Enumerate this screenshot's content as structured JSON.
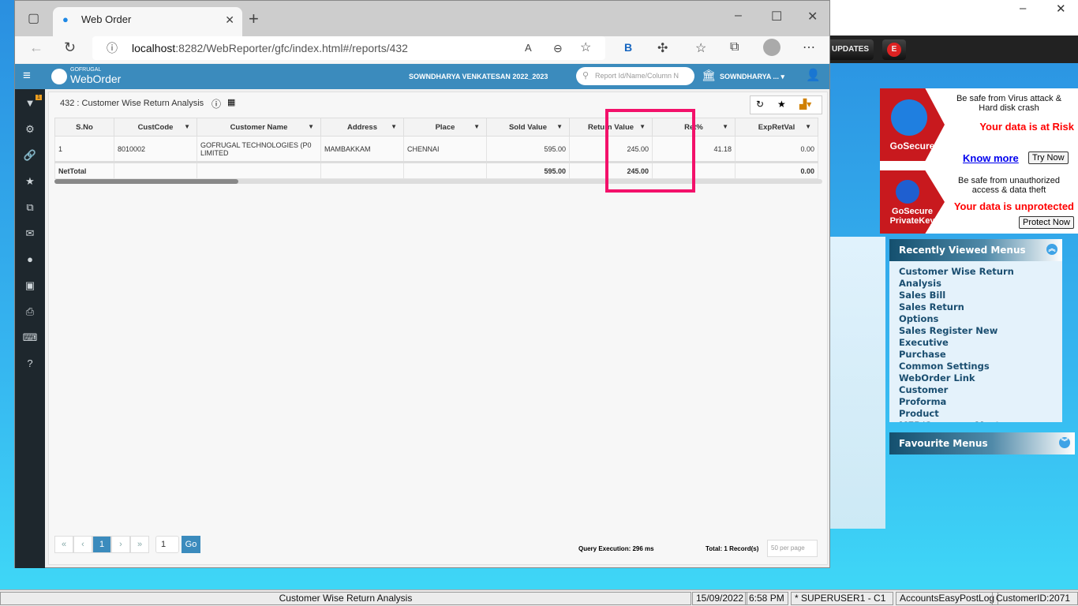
{
  "background_app": {
    "updates_label": "UPDATES",
    "e_label": "E",
    "ads": [
      {
        "brand": "GoSecure",
        "line1": "Be safe from Virus attack &",
        "line2": "Hard disk crash",
        "alert": "Your data is at Risk",
        "link": "Know more",
        "button": "Try Now"
      },
      {
        "brand": "GoSecure PrivateKey",
        "line1": "Be safe from unauthorized",
        "line2": "access & data theft",
        "alert": "Your data is unprotected",
        "button": "Protect Now"
      }
    ],
    "recently_viewed": {
      "title": "Recently Viewed Menus",
      "items": [
        "Customer Wise Return Analysis",
        "Sales Bill",
        "Sales Return",
        "Options",
        "Sales Register New",
        "Executive",
        "Purchase",
        "Common Settings",
        "WebOrder Link",
        "Customer",
        "Proforma",
        "Product",
        "MFR/Company Master"
      ]
    },
    "favourite": {
      "title": "Favourite Menus"
    },
    "statusbar": {
      "title": "Customer Wise Return Analysis",
      "date": "15/09/2022",
      "time": "6:58 PM",
      "user": "* SUPERUSER1 - C1",
      "log": "AccountsEasyPostLog",
      "customer": "CustomerID:2071"
    }
  },
  "browser": {
    "tab_title": "Web Order",
    "url_host": "localhost",
    "url_path": ":8282/WebReporter/gfc/index.html#/reports/432"
  },
  "app": {
    "brand_small": "GOFRUGAL",
    "brand": "WebOrder",
    "user_period": "SOWNDHARYA VENKATESAN 2022_2023",
    "search_placeholder": "Report Id/Name/Column N",
    "company": "SOWNDHARYA ...",
    "filter_badge": "1"
  },
  "report": {
    "title": "432 : Customer Wise Return Analysis",
    "columns": [
      "S.No",
      "CustCode",
      "Customer Name",
      "Address",
      "Place",
      "Sold Value",
      "Return Value",
      "Ret%",
      "ExpRetVal"
    ],
    "rows": [
      [
        "1",
        "8010002",
        "GOFRUGAL TECHNOLOGIES (P0 LIMITED",
        "MAMBAKKAM",
        "CHENNAI",
        "595.00",
        "245.00",
        "41.18",
        "0.00"
      ]
    ],
    "total": {
      "label": "NetTotal",
      "sold": "595.00",
      "ret": "245.00",
      "exp": "0.00"
    },
    "pager": {
      "first": "«",
      "prev": "‹",
      "page": "1",
      "next": "›",
      "last": "»",
      "goto": "1",
      "go": "Go"
    },
    "query_exec": "Query Execution: 296 ms",
    "total_records": "Total: 1 Record(s)",
    "per_page_placeholder": "50 per page"
  },
  "colors": {
    "header": "#3b8bbd",
    "highlight": "#f3116a",
    "sidebar": "#1e272d"
  }
}
